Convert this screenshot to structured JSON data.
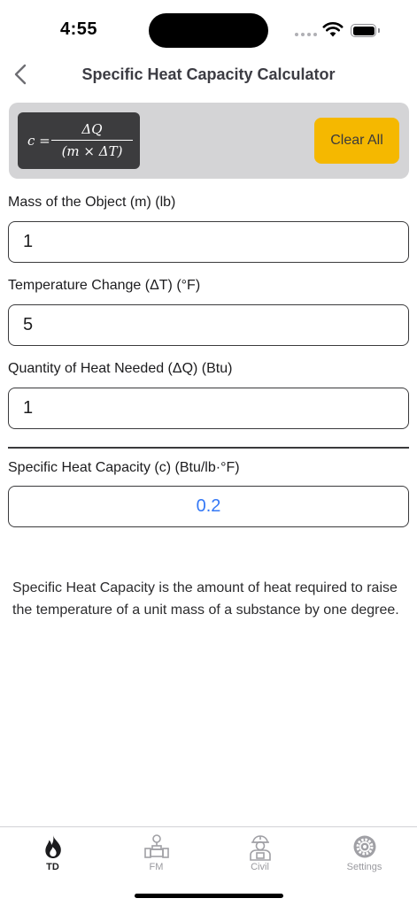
{
  "status": {
    "time": "4:55"
  },
  "nav": {
    "back_icon": "chevron-left-icon",
    "title": "Specific Heat Capacity Calculator"
  },
  "formula": {
    "lhs": "c =",
    "numerator": "ΔQ",
    "denominator": "(m × ΔT)"
  },
  "actions": {
    "clear_all_label": "Clear All"
  },
  "fields": {
    "mass": {
      "label": "Mass of the Object (m) (lb)",
      "value": "1"
    },
    "temp_change": {
      "label": "Temperature Change (ΔT) (°F)",
      "value": "5"
    },
    "heat": {
      "label": "Quantity of Heat Needed (ΔQ) (Btu)",
      "value": "1"
    }
  },
  "result": {
    "label": "Specific Heat Capacity (c) (Btu/lb·°F)",
    "value": "0.2"
  },
  "description": "Specific Heat Capacity is the amount of heat required to raise the temperature of a unit mass of a substance by one degree.",
  "tabs": [
    {
      "label": "TD",
      "icon": "flame-icon",
      "active": true
    },
    {
      "label": "FM",
      "icon": "pipe-valve-icon",
      "active": false
    },
    {
      "label": "Civil",
      "icon": "worker-icon",
      "active": false
    },
    {
      "label": "Settings",
      "icon": "gear-icon",
      "active": false
    }
  ],
  "colors": {
    "accent_yellow": "#f5b800",
    "result_blue": "#3478f6",
    "banner_gray": "#d4d4d6",
    "formula_dark": "#3c3c3e"
  }
}
